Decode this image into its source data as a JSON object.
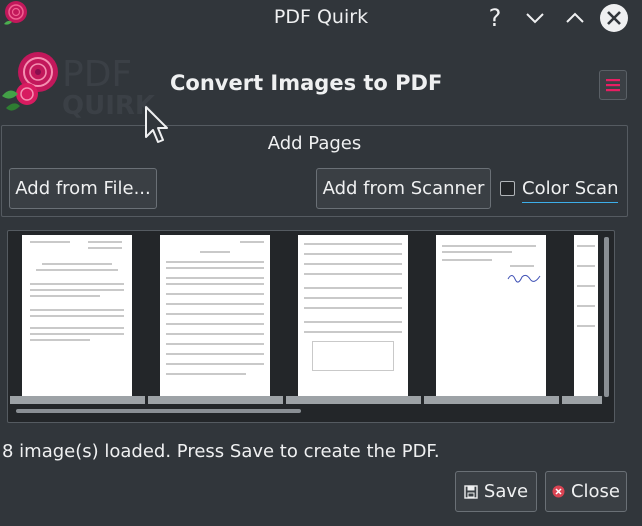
{
  "window": {
    "title": "PDF Quirk",
    "help_icon": "question-icon",
    "minimize_icon": "chevron-down-icon",
    "maximize_icon": "chevron-up-icon",
    "close_icon": "close-icon"
  },
  "header": {
    "logo_text_top": "PDF",
    "logo_text_bottom": "QUIRK",
    "heading": "Convert Images to PDF",
    "menu_icon": "hamburger-menu-icon"
  },
  "add_pages": {
    "title": "Add Pages",
    "add_from_file_label": "Add from File...",
    "add_from_scanner_label": "Add from Scanner",
    "color_scan_label": "Color Scan",
    "color_scan_checked": false
  },
  "thumbnails": {
    "count_visible": 5
  },
  "status": {
    "message": "8 image(s) loaded. Press Save to create the PDF."
  },
  "footer": {
    "save_label": "Save",
    "save_icon": "floppy-disk-icon",
    "close_label": "Close",
    "close_icon": "close-circle-icon"
  },
  "colors": {
    "background": "#31363b",
    "panel": "#232629",
    "accent": "#3daee9",
    "rose": "#c2185b"
  }
}
